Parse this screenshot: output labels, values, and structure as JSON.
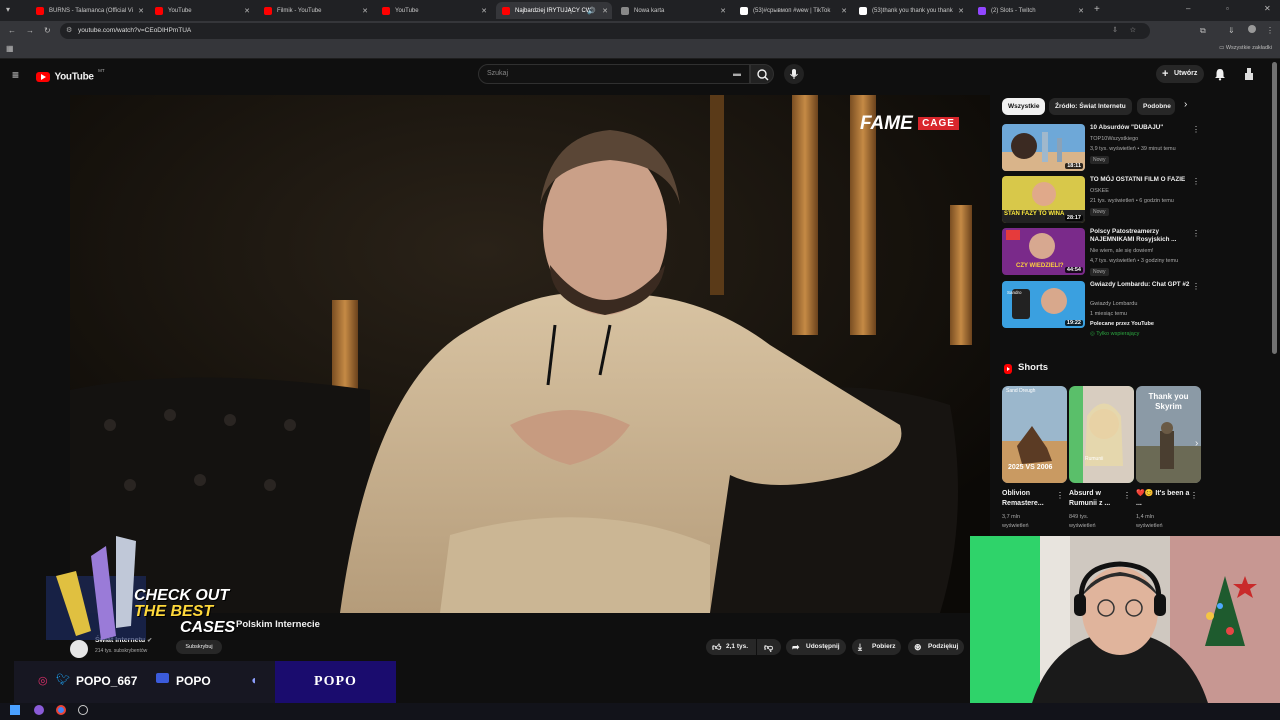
{
  "tabs": [
    {
      "label": "BURNS - Talamanca (Official Vi",
      "color": "#ff0000"
    },
    {
      "label": "YouTube",
      "color": "#ff0000"
    },
    {
      "label": "Filmik - YouTube",
      "color": "#ff0000"
    },
    {
      "label": "YouTube",
      "color": "#ff0000"
    },
    {
      "label": "Najbardziej IRYTUJĄCY CW",
      "color": "#ff0000"
    },
    {
      "label": "Nowa karta",
      "color": "#888888"
    },
    {
      "label": "(53)#срывмоп #wew | TikTok",
      "color": "#ffffff"
    },
    {
      "label": "(53)thank you thank you thank",
      "color": "#ffffff"
    },
    {
      "label": "(2) Slots - Twitch",
      "color": "#9146ff"
    }
  ],
  "browser": {
    "url": "youtube.com/watch?v=CEoDIHPmTUA",
    "all_bookmarks": "Wszystkie zakładki"
  },
  "youtube": {
    "logo": "YouTube",
    "country": "MT",
    "search_placeholder": "Szukaj",
    "create_label": "Utwórz"
  },
  "video": {
    "brand_fame": "FAME",
    "brand_cage": "CAGE",
    "title": "Polskim Internecie",
    "channel_name": "Świat Internetu",
    "channel_subs": "214 tys. subskrybentów",
    "subscribe_label": "Subskrybuj",
    "actions": {
      "likes": "2,1 tys.",
      "share": "Udostępnij",
      "download": "Pobierz",
      "thanks": "Podziękuj"
    }
  },
  "chips": [
    "Wszystkie",
    "Źródło: Świat Internetu",
    "Podobne"
  ],
  "recommendations": [
    {
      "title": "10 Absurdów \"DUBAJU\"",
      "channel": "TOP10Wszystkiego",
      "meta": "3,9 tys. wyświetleń • 39 minut temu",
      "badge": "Nowy",
      "duration": "18:11"
    },
    {
      "title": "TO MÓJ OSTATNI FILM O FAZIE",
      "channel": "OSKEE",
      "meta": "21 tys. wyświetleń • 6 godzin temu",
      "badge": "Nowy",
      "duration": "28:17",
      "thumb_text": "STAN FAZY TO WINA"
    },
    {
      "title": "Polscy Patostreamerzy NAJEMNIKAMI Rosyjskich ...",
      "channel": "Nie wiem, ale się dowiem!",
      "meta": "4,7 tys. wyświetleń • 3 godziny temu",
      "badge": "Nowy",
      "duration": "44:54",
      "thumb_text": "CZY WIEDZIELI?"
    },
    {
      "title": "Gwiazdy Lombardu: Chat GPT #2",
      "channel": "Gwiazdy Lombardu",
      "meta": "1 miesiąc temu",
      "extra": "Polecane przez YouTube",
      "member": "Tylko wspierający",
      "duration": "19:22",
      "thumb_text": "Sandro"
    }
  ],
  "shorts": {
    "title": "Shorts",
    "items": [
      {
        "title": "Oblivion Remastere...",
        "meta1": "3,7 mln",
        "meta2": "wyświetleń",
        "overlay": "2025 VS 2006",
        "top": "Sand Dreugh"
      },
      {
        "title": "Absurd w Rumunii z ...",
        "meta1": "849 tys.",
        "meta2": "wyświetleń",
        "overlay": "Rumunii",
        "top": ""
      },
      {
        "title": "❤️😊 It's been a ...",
        "meta1": "1,4 mln",
        "meta2": "wyświetleń",
        "overlay": "",
        "top": "Thank you Skyrim"
      }
    ]
  },
  "overlays": {
    "promo_line1": "CHECK OUT",
    "promo_line2": "THE BEST",
    "promo_line3": "CASES",
    "social_handle1": "POPO_667",
    "social_handle2": "POPO",
    "brand_box": "POPO"
  }
}
